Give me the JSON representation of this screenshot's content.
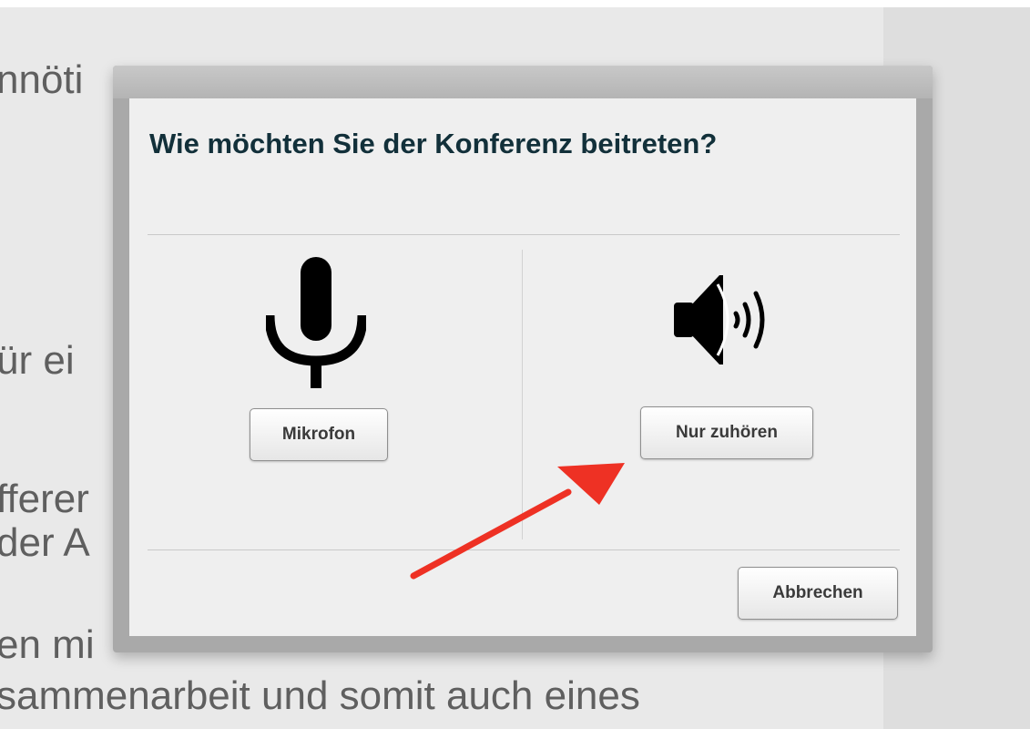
{
  "background_page": {
    "lines": [
      "nnöti",
      "ür ei",
      "fferer",
      "der A",
      "en mi",
      "sammenarbeit und somit auch eines"
    ]
  },
  "dialog": {
    "title": "Wie möchten Sie der Konferenz beitreten?",
    "options": {
      "microphone": {
        "icon": "microphone-icon",
        "label": "Mikrofon"
      },
      "listen_only": {
        "icon": "speaker-icon",
        "label": "Nur zuhören"
      }
    },
    "cancel_label": "Abbrechen"
  },
  "annotation": {
    "type": "arrow",
    "color": "#ee3124",
    "points_to": "listen-only-button"
  },
  "colors": {
    "title": "#12303a",
    "dialog_background": "#efefef",
    "dialog_frame": "#a9a9a9",
    "page_background": "#e9e9e9",
    "annotation_arrow": "#ee3124"
  }
}
